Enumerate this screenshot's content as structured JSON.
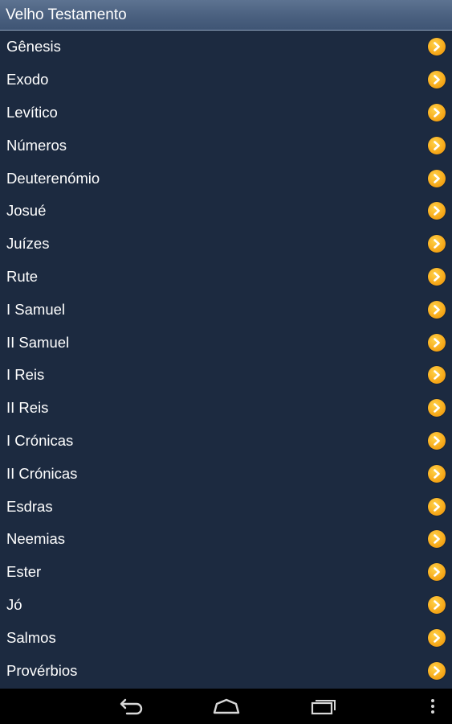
{
  "header": {
    "title": "Velho Testamento"
  },
  "books": [
    "Gênesis",
    "Exodo",
    "Levítico",
    "Números",
    "Deuterenómio",
    "Josué",
    "Juízes",
    "Rute",
    "I Samuel",
    "II Samuel",
    "I Reis",
    "II Reis",
    "I Crónicas",
    "II Crónicas",
    "Esdras",
    "Neemias",
    "Ester",
    "Jó",
    "Salmos",
    "Provérbios"
  ],
  "icons": {
    "row_action": "chevron-right-circle-icon",
    "back": "back-icon",
    "home": "home-icon",
    "recents": "recent-apps-icon",
    "menu": "overflow-menu-icon"
  },
  "colors": {
    "background": "#1c2a40",
    "header": "#4a607f",
    "accent": "#f7a91a",
    "text": "#ffffff"
  }
}
